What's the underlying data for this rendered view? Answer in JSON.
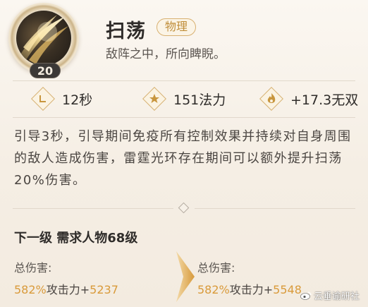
{
  "skill": {
    "name": "扫荡",
    "type_tag": "物理",
    "tagline": "敌阵之中，所向睥睨。",
    "level": "20"
  },
  "stats": {
    "cooldown": "12秒",
    "mana_cost": "151法力",
    "bonus": "+17.3无双"
  },
  "description": "引导3秒，引导期间免疫所有控制效果并持续对自身周围的敌人造成伤害，雷霆光环存在期间可以额外提升扫荡20%伤害。",
  "next_level": {
    "header": "下一级 需求人物68级",
    "current": {
      "label": "总伤害:",
      "percent": "582%",
      "mid": "攻击力+",
      "flat": "5237"
    },
    "next": {
      "label": "总伤害:",
      "percent": "582%",
      "mid": "攻击力+",
      "flat": "5548"
    }
  },
  "watermark": "云垂谕研社",
  "colors": {
    "accent_gold": "#d99a3a",
    "tag_border": "#d8b070",
    "badge_bg": "#3b3836"
  },
  "icons": {
    "skill": "sweeping-slash-icon",
    "cooldown": "clock-diamond-icon",
    "mana": "star-diamond-icon",
    "bonus": "flame-diamond-icon",
    "arrow": "chevron-right-icon"
  }
}
